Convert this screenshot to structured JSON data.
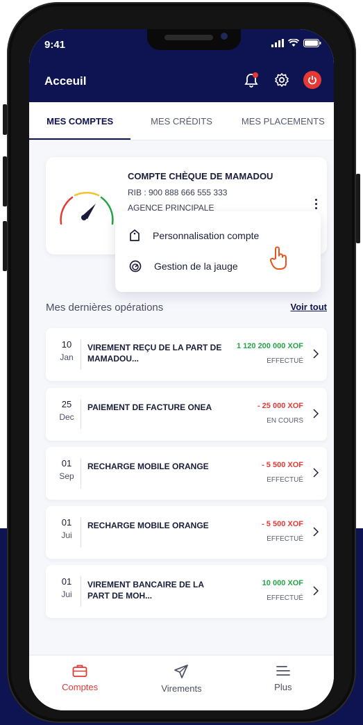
{
  "status_bar": {
    "time": "9:41"
  },
  "header": {
    "title": "Acceuil"
  },
  "tabs": [
    {
      "label": "MES COMPTES",
      "active": true
    },
    {
      "label": "MES CRÉDITS",
      "active": false
    },
    {
      "label": "MES PLACEMENTS",
      "active": false
    }
  ],
  "account": {
    "name": "COMPTE CHÈQUE DE MAMADOU",
    "rib": "RIB : 900 888 666 555 333",
    "agency": "AGENCE PRINCIPALE"
  },
  "menu": {
    "items": [
      {
        "label": "Personnalisation compte",
        "icon": "tag-icon"
      },
      {
        "label": "Gestion de la jauge",
        "icon": "gauge-icon"
      }
    ]
  },
  "operations": {
    "title": "Mes dernières opérations",
    "see_all": "Voir tout",
    "items": [
      {
        "day": "10",
        "month": "Jan",
        "label": "VIREMENT REÇU DE LA PART DE MAMADOU...",
        "amount": "1 120 200 000 XOF",
        "amount_type": "credit",
        "status": "EFFECTUÉ"
      },
      {
        "day": "25",
        "month": "Dec",
        "label": "PAIEMENT DE FACTURE ONEA",
        "amount": "- 25 000 XOF",
        "amount_type": "debit",
        "status": "EN COURS"
      },
      {
        "day": "01",
        "month": "Sep",
        "label": "RECHARGE MOBILE ORANGE",
        "amount": "- 5 500 XOF",
        "amount_type": "debit",
        "status": "EFFECTUÉ"
      },
      {
        "day": "01",
        "month": "Jui",
        "label": "RECHARGE MOBILE ORANGE",
        "amount": "- 5 500 XOF",
        "amount_type": "debit",
        "status": "EFFECTUÉ"
      },
      {
        "day": "01",
        "month": "Jui",
        "label": "VIREMENT BANCAIRE DE LA PART DE MOH...",
        "amount": "10 000 XOF",
        "amount_type": "credit",
        "status": "EFFECTUÉ"
      }
    ]
  },
  "bottom_nav": [
    {
      "label": "Comptes",
      "icon": "briefcase-icon",
      "active": true
    },
    {
      "label": "Virements",
      "icon": "paper-plane-icon",
      "active": false
    },
    {
      "label": "Plus",
      "icon": "menu-icon",
      "active": false
    }
  ],
  "colors": {
    "navy": "#0e1351",
    "red": "#e53935",
    "green": "#25a447",
    "background": "#f6f7fb"
  }
}
